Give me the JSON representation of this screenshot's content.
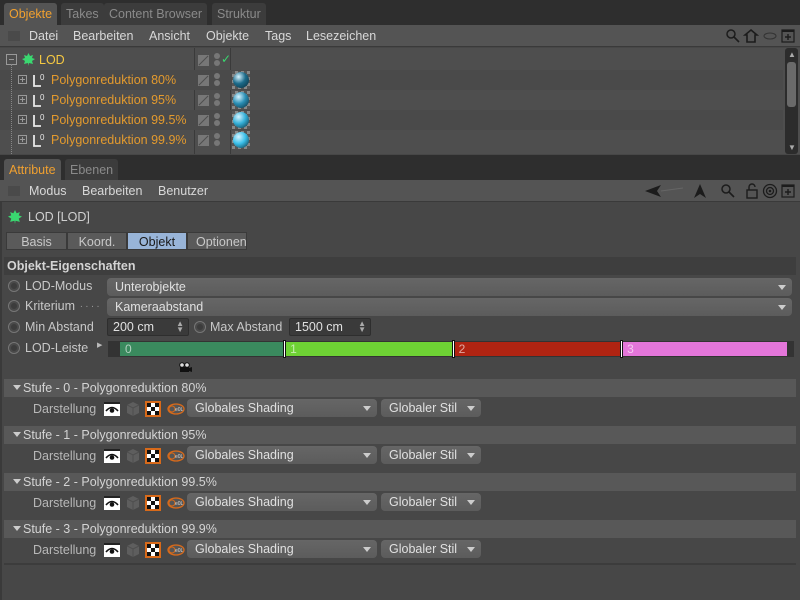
{
  "top_tabs": [
    "Objekte",
    "Takes",
    "Content Browser",
    "Struktur"
  ],
  "top_menu": [
    "Datei",
    "Bearbeiten",
    "Ansicht",
    "Objekte",
    "Tags",
    "Lesezeichen"
  ],
  "top_toolbar_icons": [
    "search-icon",
    "home-icon",
    "eye-icon",
    "new-panel-icon"
  ],
  "objects": {
    "root": {
      "name": "LOD",
      "icon": "lod-leaf-icon",
      "enabled_check": "✓"
    },
    "children": [
      {
        "name": "Polygonreduktion 80%",
        "icon": "polygon-reduction-icon",
        "badge": "0",
        "material_color": "#1c6b8a"
      },
      {
        "name": "Polygonreduktion 95%",
        "icon": "polygon-reduction-icon",
        "badge": "0",
        "material_color": "#2a8fb5"
      },
      {
        "name": "Polygonreduktion 99.5%",
        "icon": "polygon-reduction-icon",
        "badge": "0",
        "material_color": "#34b0d8"
      },
      {
        "name": "Polygonreduktion 99.9%",
        "icon": "polygon-reduction-icon",
        "badge": "0",
        "material_color": "#3ac0ea"
      }
    ]
  },
  "attr_tabs": [
    "Attribute",
    "Ebenen"
  ],
  "attr_menu": [
    "Modus",
    "Bearbeiten",
    "Benutzer"
  ],
  "attr_toolbar_icons": [
    "back-arrow-icon",
    "up-arrow-icon",
    "search-icon",
    "lock-icon",
    "target-icon",
    "new-panel-icon"
  ],
  "object_title": "LOD [LOD]",
  "sub_tabs": [
    {
      "label": "Basis",
      "active": false
    },
    {
      "label": "Koord.",
      "active": false
    },
    {
      "label": "Objekt",
      "active": true
    },
    {
      "label": "Optionen",
      "active": false
    }
  ],
  "section_title": "Objekt-Eigenschaften",
  "props": {
    "lod_modus": {
      "label": "LOD-Modus",
      "value": "Unterobjekte"
    },
    "kriterium": {
      "label": "Kriterium",
      "dots": ". . . .",
      "value": "Kameraabstand"
    },
    "min_abstand": {
      "label": "Min Abstand",
      "value": "200 cm"
    },
    "max_abstand": {
      "label": "Max Abstand",
      "value": "1500 cm"
    },
    "lod_leiste": {
      "label": "LOD-Leiste"
    }
  },
  "lod_bar": {
    "segments": [
      {
        "label": "0",
        "color": "#3a8a5e",
        "start_pct": 0,
        "end_pct": 24.5
      },
      {
        "label": "1",
        "color": "#6ed234",
        "start_pct": 24.5,
        "end_pct": 49.5
      },
      {
        "label": "2",
        "color": "#b02412",
        "start_pct": 49.5,
        "end_pct": 74.5
      },
      {
        "label": "3",
        "color": "#e476da",
        "start_pct": 74.5,
        "end_pct": 99
      }
    ]
  },
  "stufen": [
    {
      "title": "Stufe - 0 - Polygonreduktion 80%",
      "label": "Darstellung",
      "shading": "Globales Shading",
      "style": "Globaler Stil"
    },
    {
      "title": "Stufe - 1 - Polygonreduktion 95%",
      "label": "Darstellung",
      "shading": "Globales Shading",
      "style": "Globaler Stil"
    },
    {
      "title": "Stufe - 2 - Polygonreduktion 99.5%",
      "label": "Darstellung",
      "shading": "Globales Shading",
      "style": "Globaler Stil"
    },
    {
      "title": "Stufe - 3 - Polygonreduktion 99.9%",
      "label": "Darstellung",
      "shading": "Globales Shading",
      "style": "Globaler Stil"
    }
  ]
}
